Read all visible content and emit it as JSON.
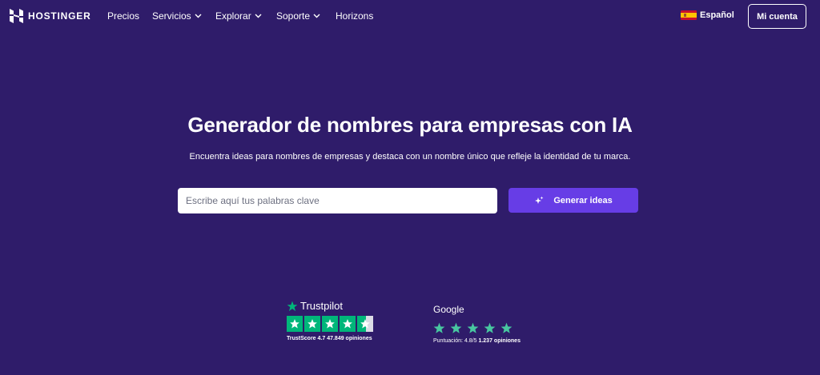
{
  "nav": {
    "brand": "HOSTINGER",
    "items": [
      {
        "label": "Precios",
        "has_dropdown": false
      },
      {
        "label": "Servicios",
        "has_dropdown": true
      },
      {
        "label": "Explorar",
        "has_dropdown": true
      },
      {
        "label": "Soporte",
        "has_dropdown": true
      },
      {
        "label": "Horizons",
        "has_dropdown": false
      }
    ],
    "language": "Español",
    "account_button": "Mi cuenta"
  },
  "hero": {
    "title": "Generador de nombres para empresas con IA",
    "subtitle": "Encuentra ideas para nombres de empresas y destaca con un nombre único que refleje la identidad de tu marca.",
    "search_placeholder": "Escribe aquí tus palabras clave",
    "search_value": "",
    "generate_button": "Generar ideas"
  },
  "reviews": {
    "trustpilot": {
      "name": "Trustpilot",
      "score_label": "TrustScore 4.7",
      "count_label": "47.849 opiniones",
      "rating": 4.5
    },
    "google": {
      "name": "Google",
      "score_label": "Puntuación: 4.8/5",
      "count_label": "1.237 opiniones",
      "rating": 5
    }
  },
  "colors": {
    "background": "#2f1c6a",
    "accent": "#673de6",
    "trustpilot_green": "#00b67a",
    "google_star": "#48c6a0"
  }
}
